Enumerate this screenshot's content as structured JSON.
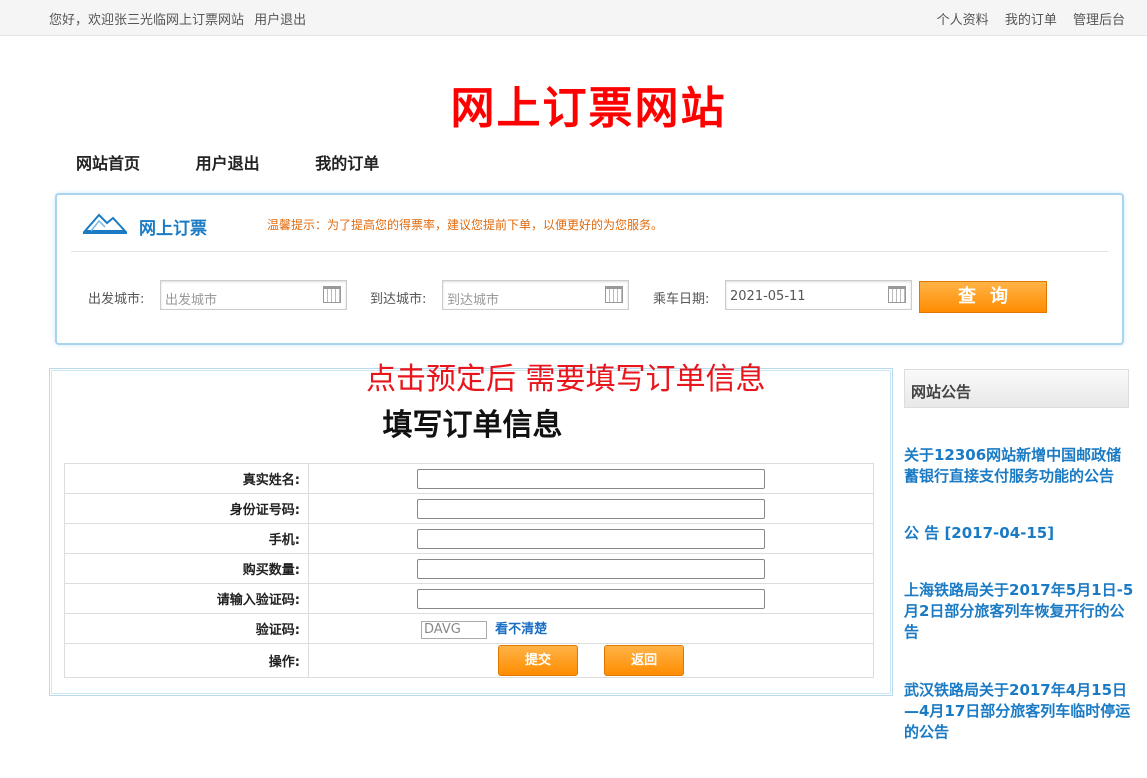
{
  "topbar": {
    "greeting": "您好，欢迎张三光临网上订票网站",
    "logout": "用户退出",
    "profile": "个人资料",
    "my_orders": "我的订单",
    "admin": "管理后台"
  },
  "site_title": "网上订票网站",
  "nav": {
    "home": "网站首页",
    "logout": "用户退出",
    "orders": "我的订单"
  },
  "search": {
    "title": "网上订票",
    "tip": "温馨提示：为了提高您的得票率，建议您提前下单，以便更好的为您服务。",
    "from_label": "出发城市:",
    "from_placeholder": "出发城市",
    "to_label": "到达城市:",
    "to_placeholder": "到达城市",
    "date_label": "乘车日期:",
    "date_value": "2021-05-11",
    "query_button": "查询"
  },
  "note": "点击预定后 需要填写订单信息",
  "order": {
    "title": "填写订单信息",
    "fields": {
      "name": "真实姓名:",
      "id": "身份证号码:",
      "phone": "手机:",
      "qty": "购买数量:",
      "code_input": "请输入验证码:",
      "code": "验证码:",
      "action": "操作:"
    },
    "captcha_text": "DAVG",
    "captcha_refresh": "看不清楚",
    "submit": "提交",
    "back": "返回"
  },
  "sidebar": {
    "title": "网站公告",
    "notices": [
      "关于12306网站新增中国邮政储蓄银行直接支付服务功能的公告",
      "公 告 [2017-04-15]",
      "上海铁路局关于2017年5月1日-5月2日部分旅客列车恢复开行的公告",
      "武汉铁路局关于2017年4月15日—4月17日部分旅客列车临时停运的公告"
    ]
  },
  "colors": {
    "brand_red": "#ff0000",
    "link_blue": "#1a7bc4",
    "accent_orange": "#ff8c00"
  }
}
